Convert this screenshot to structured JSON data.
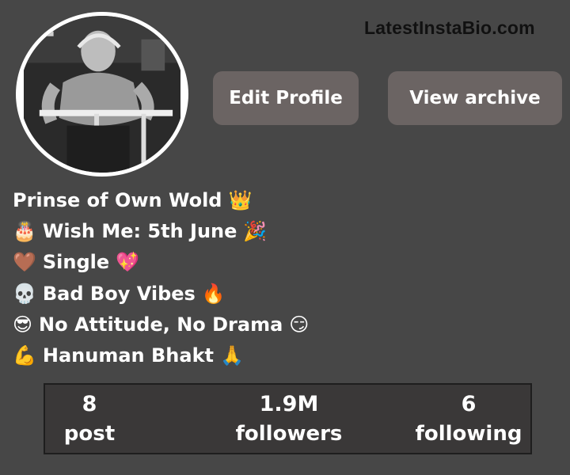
{
  "watermark": "LatestInstaBio.com",
  "profile": {
    "edit_label": "Edit Profile",
    "archive_label": "View archive"
  },
  "bio": [
    {
      "lead": "",
      "text": "Prinse of Own Wold",
      "trail": "👑",
      "icon": "crown-icon"
    },
    {
      "lead": "🎂",
      "text": "Wish Me: 5th June",
      "trail": "🎉",
      "icon": "cake-icon"
    },
    {
      "lead": "🤎",
      "text": "Single",
      "trail": "💖",
      "icon": "heart-icon"
    },
    {
      "lead": "💀",
      "text": "Bad Boy Vibes",
      "trail": "🔥",
      "icon": "skull-icon"
    },
    {
      "lead": "😎",
      "text": "No Attitude, No Drama",
      "trail": "😏",
      "icon": "sunglasses-face-icon"
    },
    {
      "lead": "💪",
      "text": "Hanuman Bhakt",
      "trail": "🙏",
      "icon": "flexed-biceps-icon"
    }
  ],
  "stats": {
    "posts": {
      "value": "8",
      "label": "post"
    },
    "followers": {
      "value": "1.9M",
      "label": "followers"
    },
    "following": {
      "value": "6",
      "label": "following"
    }
  }
}
